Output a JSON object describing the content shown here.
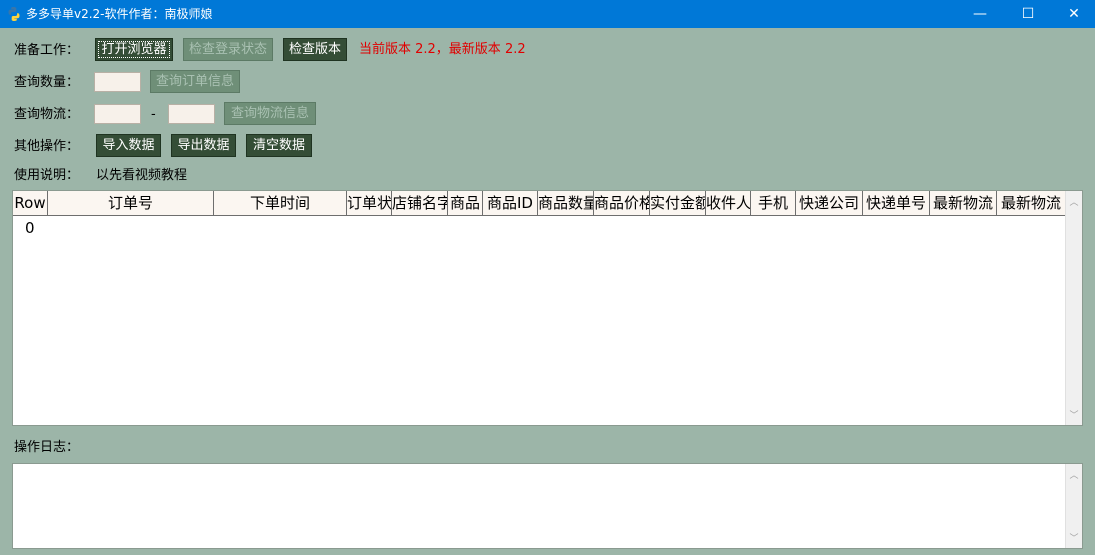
{
  "window": {
    "title": "多多导单v2.2-软件作者：南极师娘",
    "minimize_glyph": "—",
    "maximize_glyph": "☐",
    "close_glyph": "✕"
  },
  "prepare": {
    "label": "准备工作：",
    "open_browser": "打开浏览器",
    "check_login": "检查登录状态",
    "check_version": "检查版本",
    "version_info": "当前版本 2.2，最新版本 2.2"
  },
  "query_count": {
    "label": "查询数量：",
    "value": "",
    "query_button": "查询订单信息"
  },
  "query_logistics": {
    "label": "查询物流：",
    "from_value": "",
    "separator": "-",
    "to_value": "",
    "query_button": "查询物流信息"
  },
  "other_ops": {
    "label": "其他操作：",
    "import": "导入数据",
    "export": "导出数据",
    "clear": "清空数据"
  },
  "instructions": {
    "label": "使用说明：",
    "text": "以先看视频教程"
  },
  "table": {
    "columns": [
      "Row",
      "订单号",
      "下单时间",
      "订单状",
      "店铺名字",
      "商品",
      "商品ID",
      "商品数量",
      "商品价格",
      "实付金额",
      "收件人",
      "手机",
      "快递公司",
      "快递单号",
      "最新物流",
      "最新物流"
    ],
    "rows": [
      {
        "index": "0"
      }
    ]
  },
  "log": {
    "label": "操作日志：",
    "content": ""
  },
  "colors": {
    "background": "#9cb5a8",
    "titlebar": "#0078d7",
    "button": "#344d36",
    "version_text": "#e10000"
  }
}
